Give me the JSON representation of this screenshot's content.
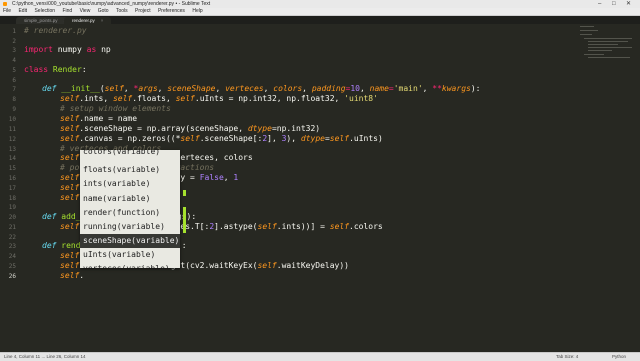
{
  "window": {
    "title": "C:\\python_vens\\000_youtube\\basic\\numpy\\advanced_numpy\\renderer.py • - Sublime Text",
    "controls": [
      "–",
      "□",
      "✕"
    ]
  },
  "menu": [
    "File",
    "Edit",
    "Selection",
    "Find",
    "View",
    "Goto",
    "Tools",
    "Project",
    "Preferences",
    "Help"
  ],
  "tabs": [
    {
      "label": "simple_points.py",
      "close": "×",
      "active": false
    },
    {
      "label": "renderer.py",
      "close": "×",
      "active": true
    }
  ],
  "line_numbers": [
    "1",
    "2",
    "3",
    "4",
    "5",
    "6",
    "7",
    "8",
    "9",
    "10",
    "11",
    "12",
    "13",
    "14",
    "15",
    "16",
    "17",
    "18",
    "19",
    "20",
    "21",
    "22",
    "23",
    "24",
    "25",
    "26"
  ],
  "current_line": "26",
  "code": {
    "l1": "# renderer.py",
    "l3_kw": "import",
    "l3_mod": " numpy ",
    "l3_as": "as",
    "l3_alias": " np",
    "l5_kw": "class",
    "l5_name": " Render",
    "l5_rest": ":",
    "l7_def": "def",
    "l7_fn": " __init__",
    "l7_p1": "(",
    "l7_self": "self",
    "l7_c1": ", ",
    "l7_star": "*",
    "l7_args": "args",
    "l7_c2": ", ",
    "l7_ss": "sceneShape",
    "l7_c3": ", ",
    "l7_vt": "verteces",
    "l7_c4": ", ",
    "l7_col": "colors",
    "l7_c5": ", ",
    "l7_pad": "padding",
    "l7_eq": "=",
    "l7_ten": "10",
    "l7_c6": ", ",
    "l7_name": "name",
    "l7_eq2": "=",
    "l7_main": "'main'",
    "l7_c7": ", ",
    "l7_ss2": "**",
    "l7_kw": "kwargs",
    "l7_end": "):",
    "l8_self": "self",
    "l8_a": ".ints, ",
    "l8_self2": "self",
    "l8_b": ".floats, ",
    "l8_self3": "self",
    "l8_c": ".uInts = np.int32, np.float32, ",
    "l8_str": "'uint8'",
    "l9": "# setup window elements",
    "l10_self": "self",
    "l10_rest": ".name = name",
    "l11_self": "self",
    "l11_a": ".sceneShape = np.array(sceneShape, ",
    "l11_dt": "dtype",
    "l11_b": "=np.int32)",
    "l12_self": "self",
    "l12_a": ".canvas = np.zeros((*",
    "l12_self2": "self",
    "l12_b": ".sceneShape[:",
    "l12_n2": "2",
    "l12_c": "], ",
    "l12_n3": "3",
    "l12_d": "), ",
    "l12_dt": "dtype",
    "l12_e": "=",
    "l12_self3": "self",
    "l12_f": ".uInts)",
    "l13": "# verteces and colors",
    "l14_self": "self",
    "l14_rest": "                  = verteces, colors",
    "l15": "# po                interactions",
    "l16_self": "self",
    "l16_a": "                 Delay = ",
    "l16_f": "False",
    "l16_b": ", ",
    "l16_n": "1",
    "l17_self": "self",
    "l18_self": "self",
    "l20_def": "def",
    "l20_fn": " add_",
    "l20_rest": "                   rgs):",
    "l21_self": "self",
    "l21_a": "                   eces.T[:",
    "l21_n": "2",
    "l21_b": "].astype(",
    "l21_self2": "self",
    "l21_c": ".ints))] = ",
    "l21_self3": "self",
    "l21_d": ".colors",
    "l23_def": "def",
    "l23_fn": " rend",
    "l23_rest": "                   s):",
    "l24_self": "self",
    "l25_self": "self",
    "l25_a": "                 s.get(cv2.waitKeyEx(",
    "l25_self2": "self",
    "l25_b": ".waitKeyDelay))",
    "l26_self": "self",
    "l26_rest": "."
  },
  "autocomplete": [
    {
      "label": "colors",
      "kind": "(variable)",
      "selected": false,
      "clipped": true
    },
    {
      "label": "floats",
      "kind": "(variable)",
      "selected": false,
      "clipped": false
    },
    {
      "label": "ints",
      "kind": "(variable)",
      "selected": false,
      "clipped": false
    },
    {
      "label": "name",
      "kind": "(variable)",
      "selected": false,
      "clipped": false
    },
    {
      "label": "render",
      "kind": "(function)",
      "selected": false,
      "clipped": false
    },
    {
      "label": "running",
      "kind": "(variable)",
      "selected": false,
      "clipped": false
    },
    {
      "label": "sceneShape",
      "kind": "(variable)",
      "selected": true,
      "clipped": false
    },
    {
      "label": "uInts",
      "kind": "(variable)",
      "selected": false,
      "clipped": false
    },
    {
      "label": "verteces",
      "kind": "(variable)",
      "selected": false,
      "clipped": true
    }
  ],
  "status": {
    "left": "Line 4, Column 11 ... Line 26, Column 14",
    "tab_size": "Tab Size: 4",
    "syntax": "Python"
  },
  "colors": {
    "background": "#272822",
    "keyword": "#f92672",
    "function": "#a6e22e",
    "self": "#fd971f",
    "number": "#ae81ff",
    "string": "#e6db74",
    "comment": "#75715e"
  }
}
